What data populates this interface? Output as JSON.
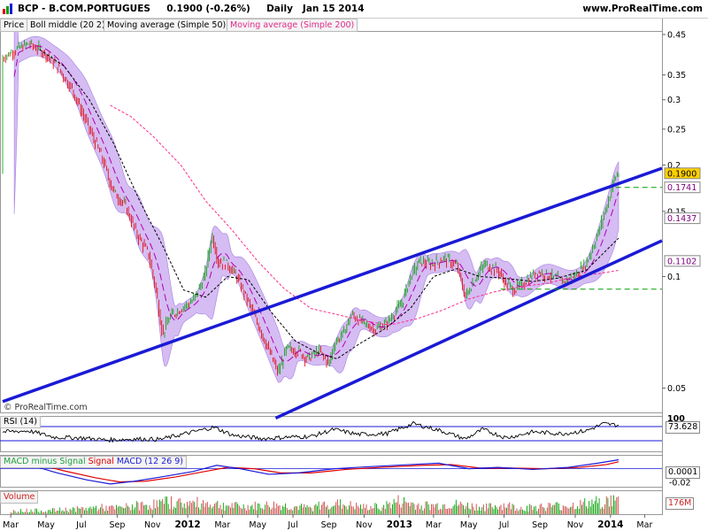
{
  "header": {
    "title": "BCP - B.COM.PORTUGUES",
    "price_change": "0.1900 (-0.26%)",
    "interval": "Daily",
    "date": "Jan 15 2014",
    "site": "www.ProRealTime.com"
  },
  "watermark": "© ProRealTime.com",
  "legend": {
    "price": "Price",
    "boll": "Boll middle (20 2)",
    "ma50": "Moving average (Simple 50)",
    "ma200": "Moving average (Simple 200)"
  },
  "colors": {
    "candle_up": "#00a000",
    "candle_down": "#e00000",
    "bollinger_band": "#c7a6ef",
    "bollinger_middle": "#b000b0",
    "ma50": "#000000",
    "ma200": "#ff2a8a",
    "channel": "#1a1ad6",
    "macd_line": "#1a1ad6",
    "signal_line": "#e00000",
    "volume": "#cc4444",
    "support_line": "#00a000"
  },
  "chart_data": [
    {
      "type": "candlestick",
      "y_scale": "log",
      "ylim": [
        0.043,
        0.46
      ],
      "x_range": [
        "2011-02-15",
        "2014-03-31"
      ],
      "y_ticks": [
        0.45,
        0.35,
        0.3,
        0.25,
        0.2,
        0.15,
        0.1,
        0.05
      ],
      "x_tick_labels": [
        {
          "date": "2011-03-01",
          "label": "Mar",
          "bold": false
        },
        {
          "date": "2011-05-01",
          "label": "May",
          "bold": false
        },
        {
          "date": "2011-07-01",
          "label": "Jul",
          "bold": false
        },
        {
          "date": "2011-09-01",
          "label": "Sep",
          "bold": false
        },
        {
          "date": "2011-11-01",
          "label": "Nov",
          "bold": false
        },
        {
          "date": "2012-01-01",
          "label": "2012",
          "bold": true
        },
        {
          "date": "2012-03-01",
          "label": "Mar",
          "bold": false
        },
        {
          "date": "2012-05-01",
          "label": "May",
          "bold": false
        },
        {
          "date": "2012-07-01",
          "label": "Jul",
          "bold": false
        },
        {
          "date": "2012-09-01",
          "label": "Sep",
          "bold": false
        },
        {
          "date": "2012-11-01",
          "label": "Nov",
          "bold": false
        },
        {
          "date": "2013-01-01",
          "label": "2013",
          "bold": true
        },
        {
          "date": "2013-03-01",
          "label": "Mar",
          "bold": false
        },
        {
          "date": "2013-05-01",
          "label": "May",
          "bold": false
        },
        {
          "date": "2013-07-01",
          "label": "Jul",
          "bold": false
        },
        {
          "date": "2013-09-01",
          "label": "Sep",
          "bold": false
        },
        {
          "date": "2013-11-01",
          "label": "Nov",
          "bold": false
        },
        {
          "date": "2014-01-01",
          "label": "2014",
          "bold": true
        },
        {
          "date": "2014-03-01",
          "label": "Mar",
          "bold": false
        }
      ],
      "price_path": [
        [
          "2011-02-15",
          0.39
        ],
        [
          "2011-03-10",
          0.41
        ],
        [
          "2011-04-01",
          0.425
        ],
        [
          "2011-04-25",
          0.405
        ],
        [
          "2011-05-20",
          0.37
        ],
        [
          "2011-06-15",
          0.32
        ],
        [
          "2011-07-10",
          0.26
        ],
        [
          "2011-08-05",
          0.21
        ],
        [
          "2011-08-25",
          0.17
        ],
        [
          "2011-09-15",
          0.155
        ],
        [
          "2011-10-05",
          0.13
        ],
        [
          "2011-10-25",
          0.115
        ],
        [
          "2011-11-08",
          0.09
        ],
        [
          "2011-11-18",
          0.07
        ],
        [
          "2011-12-01",
          0.078
        ],
        [
          "2011-12-20",
          0.082
        ],
        [
          "2012-01-10",
          0.086
        ],
        [
          "2012-01-30",
          0.1
        ],
        [
          "2012-02-12",
          0.13
        ],
        [
          "2012-02-22",
          0.11
        ],
        [
          "2012-03-10",
          0.108
        ],
        [
          "2012-03-25",
          0.1
        ],
        [
          "2012-04-15",
          0.085
        ],
        [
          "2012-05-05",
          0.072
        ],
        [
          "2012-05-22",
          0.062
        ],
        [
          "2012-06-05",
          0.055
        ],
        [
          "2012-06-20",
          0.064
        ],
        [
          "2012-07-10",
          0.063
        ],
        [
          "2012-07-25",
          0.06
        ],
        [
          "2012-08-15",
          0.063
        ],
        [
          "2012-09-01",
          0.058
        ],
        [
          "2012-09-10",
          0.066
        ],
        [
          "2012-09-25",
          0.07
        ],
        [
          "2012-10-10",
          0.079
        ],
        [
          "2012-10-30",
          0.075
        ],
        [
          "2012-11-20",
          0.072
        ],
        [
          "2012-12-10",
          0.075
        ],
        [
          "2013-01-05",
          0.085
        ],
        [
          "2013-01-20",
          0.1
        ],
        [
          "2013-02-05",
          0.11
        ],
        [
          "2013-02-25",
          0.108
        ],
        [
          "2013-03-20",
          0.112
        ],
        [
          "2013-04-10",
          0.107
        ],
        [
          "2013-04-25",
          0.088
        ],
        [
          "2013-05-10",
          0.098
        ],
        [
          "2013-05-28",
          0.108
        ],
        [
          "2013-06-20",
          0.104
        ],
        [
          "2013-07-05",
          0.095
        ],
        [
          "2013-07-20",
          0.092
        ],
        [
          "2013-08-10",
          0.098
        ],
        [
          "2013-08-25",
          0.103
        ],
        [
          "2013-09-15",
          0.101
        ],
        [
          "2013-10-10",
          0.097
        ],
        [
          "2013-10-30",
          0.1
        ],
        [
          "2013-11-20",
          0.109
        ],
        [
          "2013-12-10",
          0.13
        ],
        [
          "2013-12-25",
          0.155
        ],
        [
          "2014-01-08",
          0.185
        ],
        [
          "2014-01-15",
          0.19
        ]
      ],
      "price_labels": [
        {
          "label": "0.1900",
          "value": 0.19,
          "highlight": true
        },
        {
          "label": "0.1741",
          "value": 0.1741,
          "highlight": false
        },
        {
          "label": "0.1437",
          "value": 0.1437,
          "highlight": false
        },
        {
          "label": "0.1102",
          "value": 0.1102,
          "highlight": false
        }
      ],
      "ma50_path": [
        [
          "2011-04-20",
          0.41
        ],
        [
          "2011-06-01",
          0.37
        ],
        [
          "2011-07-15",
          0.3
        ],
        [
          "2011-08-25",
          0.23
        ],
        [
          "2011-10-10",
          0.16
        ],
        [
          "2011-11-20",
          0.12
        ],
        [
          "2011-12-25",
          0.092
        ],
        [
          "2012-02-01",
          0.088
        ],
        [
          "2012-03-10",
          0.1
        ],
        [
          "2012-04-15",
          0.098
        ],
        [
          "2012-05-25",
          0.08
        ],
        [
          "2012-07-05",
          0.067
        ],
        [
          "2012-08-15",
          0.062
        ],
        [
          "2012-09-15",
          0.06
        ],
        [
          "2012-10-25",
          0.066
        ],
        [
          "2012-12-05",
          0.072
        ],
        [
          "2013-01-20",
          0.082
        ],
        [
          "2013-03-01",
          0.1
        ],
        [
          "2013-04-10",
          0.105
        ],
        [
          "2013-05-20",
          0.1
        ],
        [
          "2013-07-01",
          0.099
        ],
        [
          "2013-08-20",
          0.097
        ],
        [
          "2013-10-01",
          0.099
        ],
        [
          "2013-11-20",
          0.104
        ],
        [
          "2014-01-15",
          0.127
        ]
      ],
      "ma200_path": [
        [
          "2011-08-20",
          0.29
        ],
        [
          "2011-09-25",
          0.27
        ],
        [
          "2011-11-01",
          0.24
        ],
        [
          "2011-12-20",
          0.2
        ],
        [
          "2012-02-01",
          0.16
        ],
        [
          "2012-03-15",
          0.135
        ],
        [
          "2012-05-01",
          0.11
        ],
        [
          "2012-06-15",
          0.093
        ],
        [
          "2012-08-01",
          0.082
        ],
        [
          "2012-09-15",
          0.079
        ],
        [
          "2012-10-30",
          0.076
        ],
        [
          "2012-12-15",
          0.074
        ],
        [
          "2013-02-01",
          0.077
        ],
        [
          "2013-03-15",
          0.081
        ],
        [
          "2013-05-01",
          0.087
        ],
        [
          "2013-06-15",
          0.091
        ],
        [
          "2013-08-01",
          0.094
        ],
        [
          "2013-09-15",
          0.096
        ],
        [
          "2013-11-01",
          0.1
        ],
        [
          "2013-12-15",
          0.102
        ],
        [
          "2014-01-15",
          0.104
        ]
      ],
      "channel_lines": [
        {
          "from": [
            "2011-02-15",
            0.046
          ],
          "to": [
            "2014-03-31",
            0.196
          ]
        },
        {
          "from": [
            "2012-06-01",
            0.0415
          ],
          "to": [
            "2014-03-31",
            0.125
          ]
        }
      ],
      "level_lines": [
        {
          "value": 0.1741,
          "from": "2014-01-10"
        },
        {
          "value": 0.0925,
          "from": "2013-06-25"
        }
      ]
    },
    {
      "type": "line",
      "name": "RSI (14)",
      "value_label": "73.628",
      "ylim": [
        0,
        100
      ],
      "top_tick": "100",
      "levels": [
        70,
        30
      ],
      "path": [
        [
          "2011-02-15",
          55
        ],
        [
          "2011-04-01",
          58
        ],
        [
          "2011-05-15",
          40
        ],
        [
          "2011-07-01",
          38
        ],
        [
          "2011-08-15",
          32
        ],
        [
          "2011-10-01",
          35
        ],
        [
          "2011-11-15",
          34
        ],
        [
          "2012-01-10",
          55
        ],
        [
          "2012-02-15",
          68
        ],
        [
          "2012-03-20",
          45
        ],
        [
          "2012-05-10",
          36
        ],
        [
          "2012-06-20",
          40
        ],
        [
          "2012-08-01",
          42
        ],
        [
          "2012-09-10",
          62
        ],
        [
          "2012-10-20",
          48
        ],
        [
          "2012-12-10",
          50
        ],
        [
          "2013-01-25",
          78
        ],
        [
          "2013-03-10",
          60
        ],
        [
          "2013-04-25",
          35
        ],
        [
          "2013-05-25",
          62
        ],
        [
          "2013-07-05",
          38
        ],
        [
          "2013-08-20",
          55
        ],
        [
          "2013-10-10",
          50
        ],
        [
          "2013-11-20",
          58
        ],
        [
          "2013-12-20",
          78
        ],
        [
          "2014-01-15",
          73.6
        ]
      ]
    },
    {
      "type": "line",
      "series": [
        {
          "name": "MACD minus Signal"
        },
        {
          "name": "Signal"
        },
        {
          "name": "MACD (12 26 9)"
        }
      ],
      "value_label": "0.0001",
      "ylim": [
        -0.026,
        0.02
      ],
      "y_ticks": [
        -0.02
      ],
      "macd_path": [
        [
          "2011-02-15",
          0.008
        ],
        [
          "2011-04-01",
          0.006
        ],
        [
          "2011-05-20",
          -0.006
        ],
        [
          "2011-07-10",
          -0.016
        ],
        [
          "2011-08-20",
          -0.022
        ],
        [
          "2011-10-01",
          -0.018
        ],
        [
          "2011-11-15",
          -0.012
        ],
        [
          "2012-01-10",
          -0.004
        ],
        [
          "2012-02-20",
          0.005
        ],
        [
          "2012-04-01",
          0.0
        ],
        [
          "2012-05-20",
          -0.008
        ],
        [
          "2012-07-10",
          -0.006
        ],
        [
          "2012-09-10",
          0.0
        ],
        [
          "2012-11-10",
          0.003
        ],
        [
          "2013-01-20",
          0.006
        ],
        [
          "2013-03-10",
          0.008
        ],
        [
          "2013-05-01",
          0.0
        ],
        [
          "2013-06-20",
          0.002
        ],
        [
          "2013-08-20",
          -0.001
        ],
        [
          "2013-10-20",
          0.002
        ],
        [
          "2013-12-10",
          0.008
        ],
        [
          "2014-01-15",
          0.013
        ]
      ],
      "signal_path": [
        [
          "2011-02-15",
          0.008
        ],
        [
          "2011-04-15",
          0.007
        ],
        [
          "2011-06-01",
          -0.003
        ],
        [
          "2011-07-25",
          -0.013
        ],
        [
          "2011-09-05",
          -0.019
        ],
        [
          "2011-10-20",
          -0.018
        ],
        [
          "2011-12-10",
          -0.012
        ],
        [
          "2012-01-30",
          -0.004
        ],
        [
          "2012-03-10",
          0.002
        ],
        [
          "2012-04-25",
          0.0
        ],
        [
          "2012-06-10",
          -0.006
        ],
        [
          "2012-08-01",
          -0.006
        ],
        [
          "2012-10-01",
          -0.001
        ],
        [
          "2012-12-01",
          0.002
        ],
        [
          "2013-02-10",
          0.005
        ],
        [
          "2013-04-01",
          0.006
        ],
        [
          "2013-05-20",
          0.001
        ],
        [
          "2013-07-10",
          0.001
        ],
        [
          "2013-09-10",
          0.0
        ],
        [
          "2013-11-10",
          0.002
        ],
        [
          "2013-12-25",
          0.006
        ],
        [
          "2014-01-15",
          0.01
        ]
      ]
    },
    {
      "type": "bar",
      "name": "Volume",
      "value_label": "176M",
      "ylim": [
        0,
        200
      ],
      "y_ticks": [
        176
      ],
      "bars": [
        [
          "2011-03-01",
          40
        ],
        [
          "2011-04-01",
          50
        ],
        [
          "2011-05-01",
          45
        ],
        [
          "2011-06-01",
          60
        ],
        [
          "2011-07-01",
          70
        ],
        [
          "2011-08-01",
          90
        ],
        [
          "2011-09-01",
          80
        ],
        [
          "2011-10-01",
          110
        ],
        [
          "2011-11-01",
          130
        ],
        [
          "2011-12-01",
          160
        ],
        [
          "2012-01-01",
          140
        ],
        [
          "2012-02-01",
          150
        ],
        [
          "2012-03-01",
          120
        ],
        [
          "2012-04-01",
          100
        ],
        [
          "2012-05-01",
          110
        ],
        [
          "2012-06-01",
          120
        ],
        [
          "2012-07-01",
          100
        ],
        [
          "2012-08-01",
          80
        ],
        [
          "2012-09-01",
          150
        ],
        [
          "2012-10-01",
          120
        ],
        [
          "2012-11-01",
          90
        ],
        [
          "2012-12-01",
          100
        ],
        [
          "2013-01-01",
          170
        ],
        [
          "2013-02-01",
          120
        ],
        [
          "2013-03-01",
          110
        ],
        [
          "2013-04-01",
          130
        ],
        [
          "2013-05-01",
          110
        ],
        [
          "2013-06-01",
          90
        ],
        [
          "2013-07-01",
          120
        ],
        [
          "2013-08-01",
          80
        ],
        [
          "2013-09-01",
          100
        ],
        [
          "2013-10-01",
          110
        ],
        [
          "2013-11-01",
          120
        ],
        [
          "2013-12-01",
          150
        ],
        [
          "2014-01-01",
          176
        ]
      ]
    }
  ]
}
